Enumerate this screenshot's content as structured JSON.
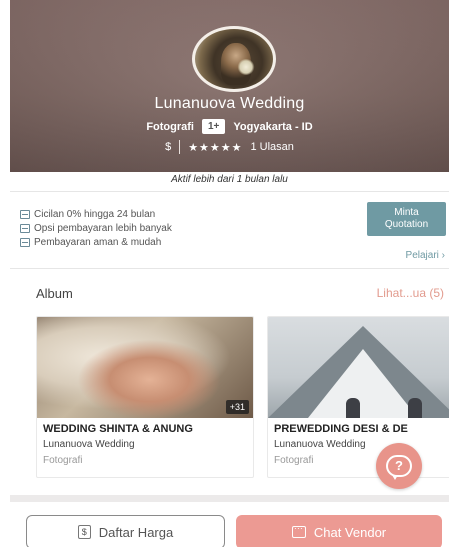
{
  "vendor": {
    "name": "Lunanuova Wedding",
    "category": "Fotografi",
    "badge": "1+",
    "location": "Yogyakarta - ID",
    "price_symbol": "$",
    "stars": "★★★★★",
    "reviews": "1 Ulasan"
  },
  "activity": "Aktif lebih dari 1 bulan lalu",
  "payment": {
    "items": [
      {
        "icon": "installment-icon",
        "label": "Cicilan 0% hingga 24 bulan"
      },
      {
        "icon": "wallet-icon",
        "label": "Opsi pembayaran lebih banyak"
      },
      {
        "icon": "secure-payment-icon",
        "label": "Pembayaran aman & mudah"
      }
    ],
    "quote_line1": "Minta",
    "quote_line2": "Quotation",
    "learn_more": "Pelajari ›"
  },
  "album": {
    "title": "Album",
    "see_all": "Lihat...ua (5)",
    "cards": [
      {
        "title": "WEDDING SHINTA & ANUNG",
        "vendor": "Lunanuova Wedding",
        "category": "Fotografi",
        "badge": "+31"
      },
      {
        "title": "PREWEDDING DESI & DE",
        "vendor": "Lunanuova Wedding",
        "category": "Fotografi",
        "badge": ""
      }
    ]
  },
  "bottom_bar": {
    "price_icon": "$",
    "price_label": "Daftar Harga",
    "chat_label": "Chat Vendor"
  },
  "help": {
    "label": "?"
  },
  "colors": {
    "accent_teal": "#6f9aa3",
    "accent_pink": "#ec9a93",
    "hero_bg": "#7d6560"
  }
}
